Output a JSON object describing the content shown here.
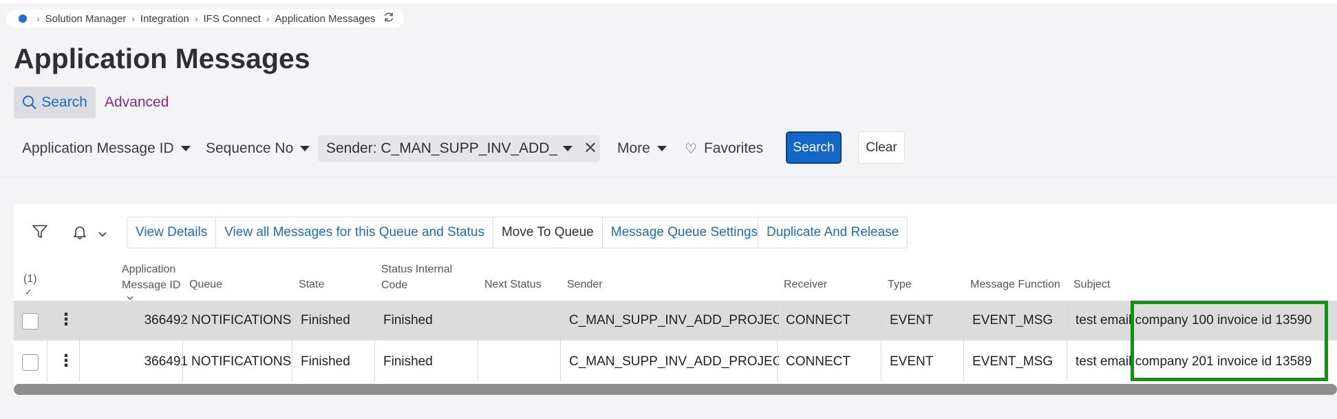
{
  "breadcrumb": {
    "items": [
      "Solution Manager",
      "Integration",
      "IFS Connect",
      "Application Messages"
    ],
    "separator": ">"
  },
  "page_title": "Application Messages",
  "search_tabs": {
    "search": "Search",
    "advanced": "Advanced"
  },
  "filters": {
    "application_message_id": "Application Message ID",
    "sequence_no": "Sequence No",
    "sender_chip": "Sender: C_MAN_SUPP_INV_ADD_P...",
    "more": "More",
    "favorites": "Favorites",
    "search_button": "Search",
    "clear_button": "Clear"
  },
  "commands": {
    "view_details": "View Details",
    "view_all_messages": "View all Messages for this Queue and Status",
    "move_to_queue": "Move To Queue",
    "message_queue_settings": "Message Queue Settings",
    "duplicate_and_release": "Duplicate And Release"
  },
  "table": {
    "selection_count": "(1)",
    "headers": {
      "app_msg_id_line1": "Application",
      "app_msg_id_line2": "Message ID",
      "queue": "Queue",
      "state": "State",
      "status_internal_line1": "Status Internal",
      "status_internal_line2": "Code",
      "next_status": "Next Status",
      "sender": "Sender",
      "receiver": "Receiver",
      "type": "Type",
      "message_function": "Message Function",
      "subject": "Subject"
    },
    "rows": [
      {
        "id": "366492",
        "queue": "NOTIFICATIONS",
        "state": "Finished",
        "status_internal": "Finished",
        "next_status": "",
        "sender": "C_MAN_SUPP_INV_ADD_PROJECT",
        "receiver": "CONNECT",
        "type": "EVENT",
        "message_function": "EVENT_MSG",
        "subject": "test email company 100 invoice id  13590"
      },
      {
        "id": "366491",
        "queue": "NOTIFICATIONS",
        "state": "Finished",
        "status_internal": "Finished",
        "next_status": "",
        "sender": "C_MAN_SUPP_INV_ADD_PROJECT",
        "receiver": "CONNECT",
        "type": "EVENT",
        "message_function": "EVENT_MSG",
        "subject": "test email company 201 invoice id  13589"
      }
    ]
  },
  "colors": {
    "accent": "#1466c8",
    "link": "#1a6cc0",
    "advanced_link": "#7a2f82",
    "highlight_box": "#119311"
  },
  "icons": {
    "home": "home-dot-icon",
    "refresh": "refresh-icon",
    "search": "search-icon",
    "filter": "filter-icon",
    "bell": "bell-icon",
    "heart": "heart-icon",
    "close": "close-icon",
    "kebab": "kebab-menu-icon"
  }
}
